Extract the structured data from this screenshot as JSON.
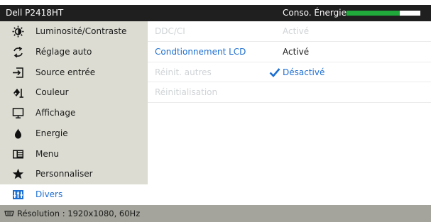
{
  "header": {
    "model": "Dell P2418HT",
    "energy_label": "Conso. Énergie",
    "energy_level": 0.72
  },
  "sidebar": {
    "items": [
      {
        "label": "Luminosité/Contraste",
        "icon": "brightness-icon"
      },
      {
        "label": "Réglage auto",
        "icon": "auto-adjust-icon"
      },
      {
        "label": "Source entrée",
        "icon": "input-source-icon"
      },
      {
        "label": "Couleur",
        "icon": "color-icon"
      },
      {
        "label": "Affichage",
        "icon": "display-icon"
      },
      {
        "label": "Energie",
        "icon": "energy-icon"
      },
      {
        "label": "Menu",
        "icon": "menu-icon"
      },
      {
        "label": "Personnaliser",
        "icon": "star-icon"
      },
      {
        "label": "Divers",
        "icon": "others-icon",
        "active": true
      }
    ]
  },
  "main": {
    "rows": [
      {
        "name": "DDC/CI",
        "value": "Activé"
      },
      {
        "name": "Condtionnement LCD",
        "value": "Activé"
      },
      {
        "name": "Réinit. autres",
        "value": "Désactivé"
      },
      {
        "name": "Réinitialisation",
        "value": ""
      }
    ]
  },
  "footer": {
    "resolution": "Résolution : 1920x1080, 60Hz"
  },
  "colors": {
    "accent": "#1c6ed1",
    "energy_green": "#1faa3b",
    "header_bg": "#1f1f1f",
    "sidebar_bg": "#dcdcd3",
    "footer_bg": "#a4a49c"
  }
}
